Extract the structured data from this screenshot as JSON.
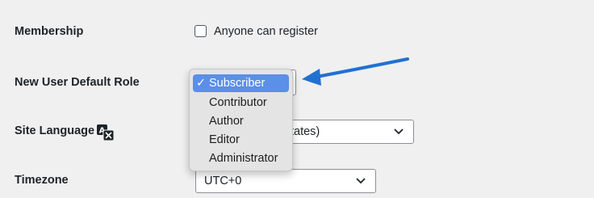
{
  "settings": {
    "membership": {
      "label": "Membership",
      "checkbox_label": "Anyone can register",
      "checked": false
    },
    "default_role": {
      "label": "New User Default Role",
      "options": [
        "Subscriber",
        "Contributor",
        "Author",
        "Editor",
        "Administrator"
      ],
      "selected": "Subscriber",
      "check_mark": "✓"
    },
    "site_language": {
      "label": "Site Language",
      "value_visible": "tates)",
      "icon": "translate-icon"
    },
    "timezone": {
      "label": "Timezone",
      "value": "UTC+0"
    }
  },
  "colors": {
    "page_background": "#f0f0f1",
    "highlight": "#5b8fe8",
    "arrow": "#2271d1"
  }
}
